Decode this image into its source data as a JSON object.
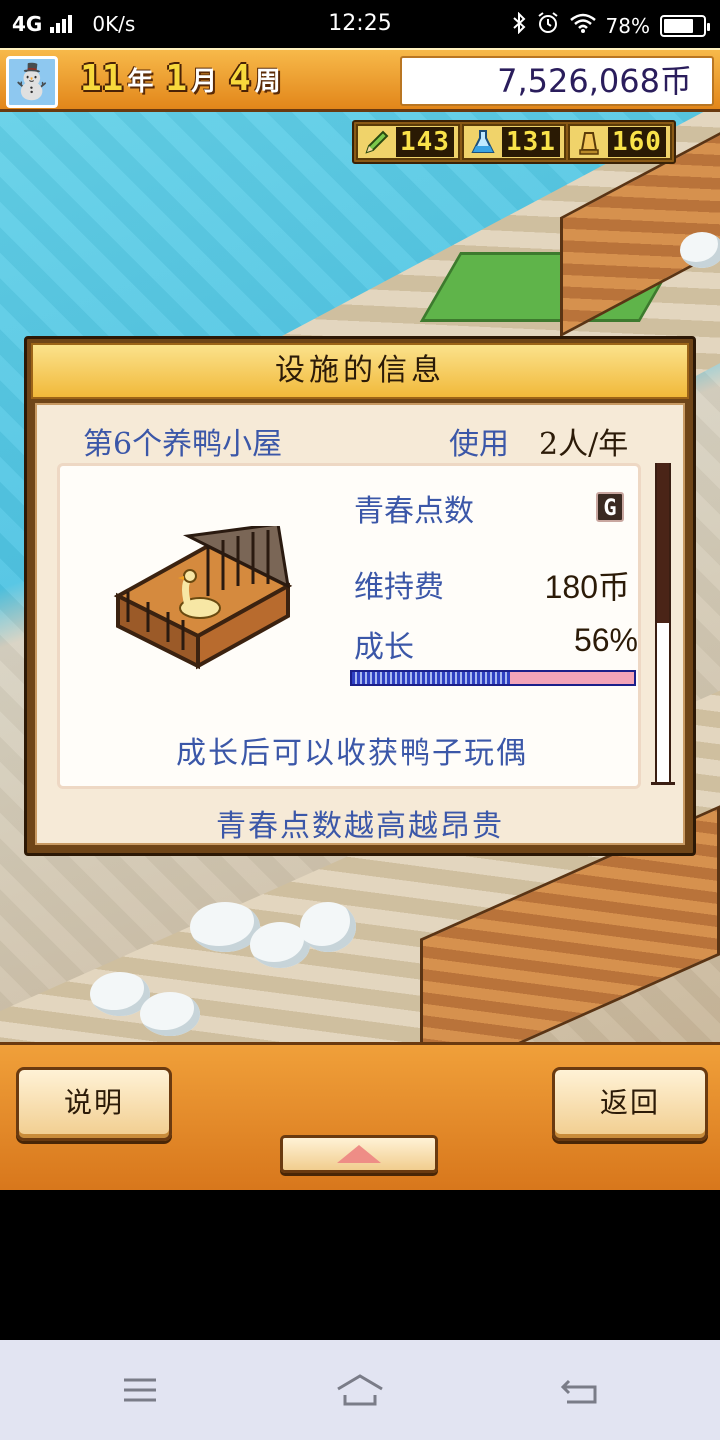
{
  "status_bar": {
    "network": "4G",
    "speed": "0K/s",
    "time": "12:25",
    "battery": "78%",
    "battery_level": 0.78,
    "icons": [
      "bluetooth-icon",
      "alarm-icon",
      "wifi-icon"
    ]
  },
  "header": {
    "avatar_icon": "snowman-icon",
    "date": {
      "year": "11",
      "year_unit": "年",
      "month": "1",
      "month_unit": "月",
      "week": "4",
      "week_unit": "周"
    },
    "money": "7,526,068币"
  },
  "resources": [
    {
      "icon": "pencil-icon",
      "value": "143"
    },
    {
      "icon": "flask-icon",
      "value": "131"
    },
    {
      "icon": "bell-icon",
      "value": "160"
    }
  ],
  "dialog": {
    "title": "设施的信息",
    "facility_name": "第6个养鸭小屋",
    "usage_label": "使用",
    "usage_value": "2人/年",
    "youth_points_label": "青春点数",
    "youth_points_grade": "G",
    "maintenance_label": "维持费",
    "maintenance_value": "180币",
    "growth_label": "成长",
    "growth_value": "56%",
    "growth_fraction": 0.56,
    "hint": "成长后可以收获鸭子玩偶",
    "footer_note": "青春点数越高越昂贵",
    "scroll_fraction": 0.5
  },
  "bottom": {
    "help_label": "说明",
    "back_label": "返回",
    "up_icon": "up-arrow-icon"
  },
  "navbar": {
    "icons": [
      "menu-icon",
      "home-icon",
      "back-icon"
    ]
  },
  "colors": {
    "header_orange": "#e8951f",
    "dialog_text_blue": "#3b57a8",
    "progress_blue": "#2f3fc4",
    "progress_pink": "#f3a4b8"
  }
}
